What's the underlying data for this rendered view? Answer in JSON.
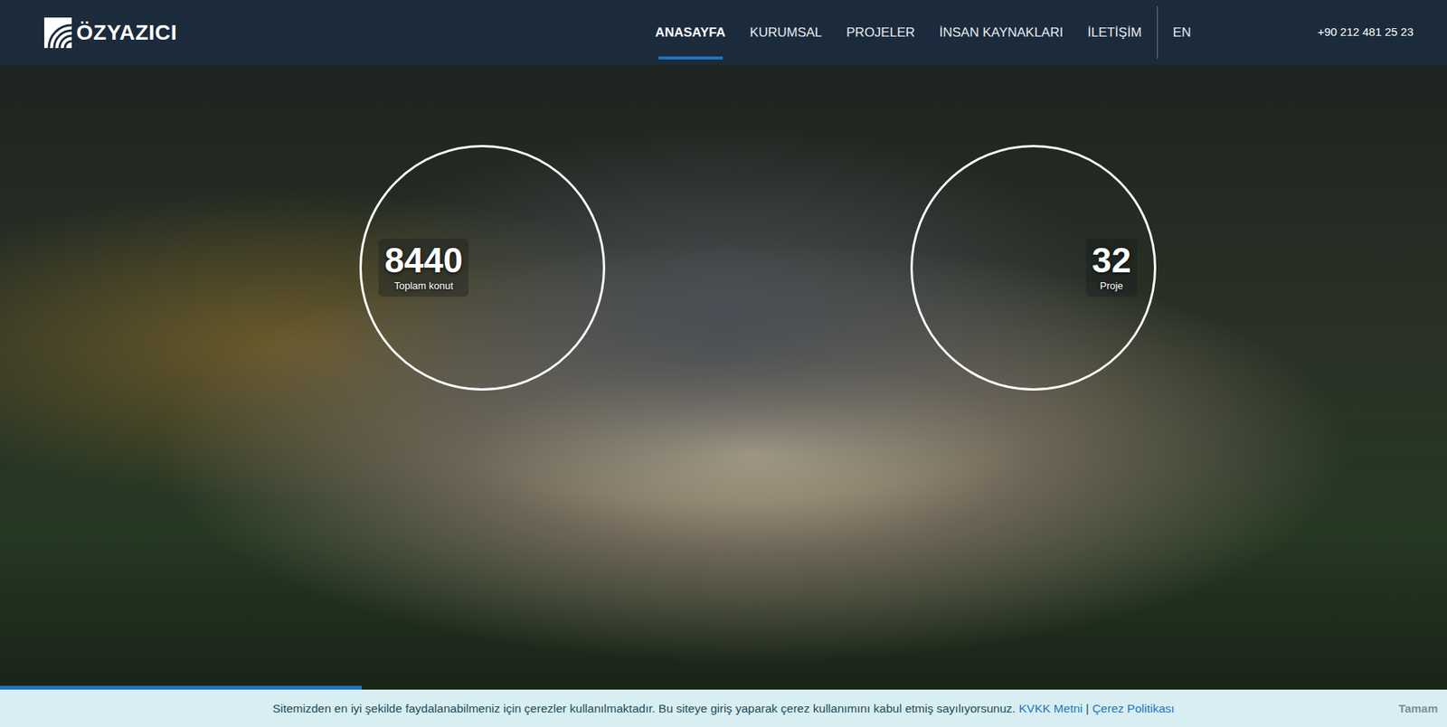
{
  "header": {
    "logo": "ÖZYAZICI",
    "nav": [
      {
        "label": "ANASAYFA",
        "selected": true
      },
      {
        "label": "KURUMSAL",
        "selected": false
      },
      {
        "label": "PROJELER",
        "selected": false
      },
      {
        "label": "İNSAN KAYNAKLARI",
        "selected": false
      },
      {
        "label": "İLETİŞİM",
        "selected": false
      }
    ],
    "language": "EN",
    "phone": "+90 212 481 25 23"
  },
  "hero": {
    "stats": [
      {
        "value": "8440",
        "label": "Toplam konut"
      },
      {
        "value": "32",
        "label": "Proje"
      }
    ],
    "slide_progress": {
      "level": 0.25
    }
  },
  "cookie_bar": {
    "text": "Sitemizden en iyi şekilde faydalanabilmeniz için çerezler kullanılmaktadır. Bu siteye giriş yaparak çerez kullanımını kabul etmiş sayılıyorsunuz.",
    "links": [
      "KVKK Metni",
      "Çerez Politikası"
    ],
    "separator": "|",
    "button": "Tamam"
  }
}
